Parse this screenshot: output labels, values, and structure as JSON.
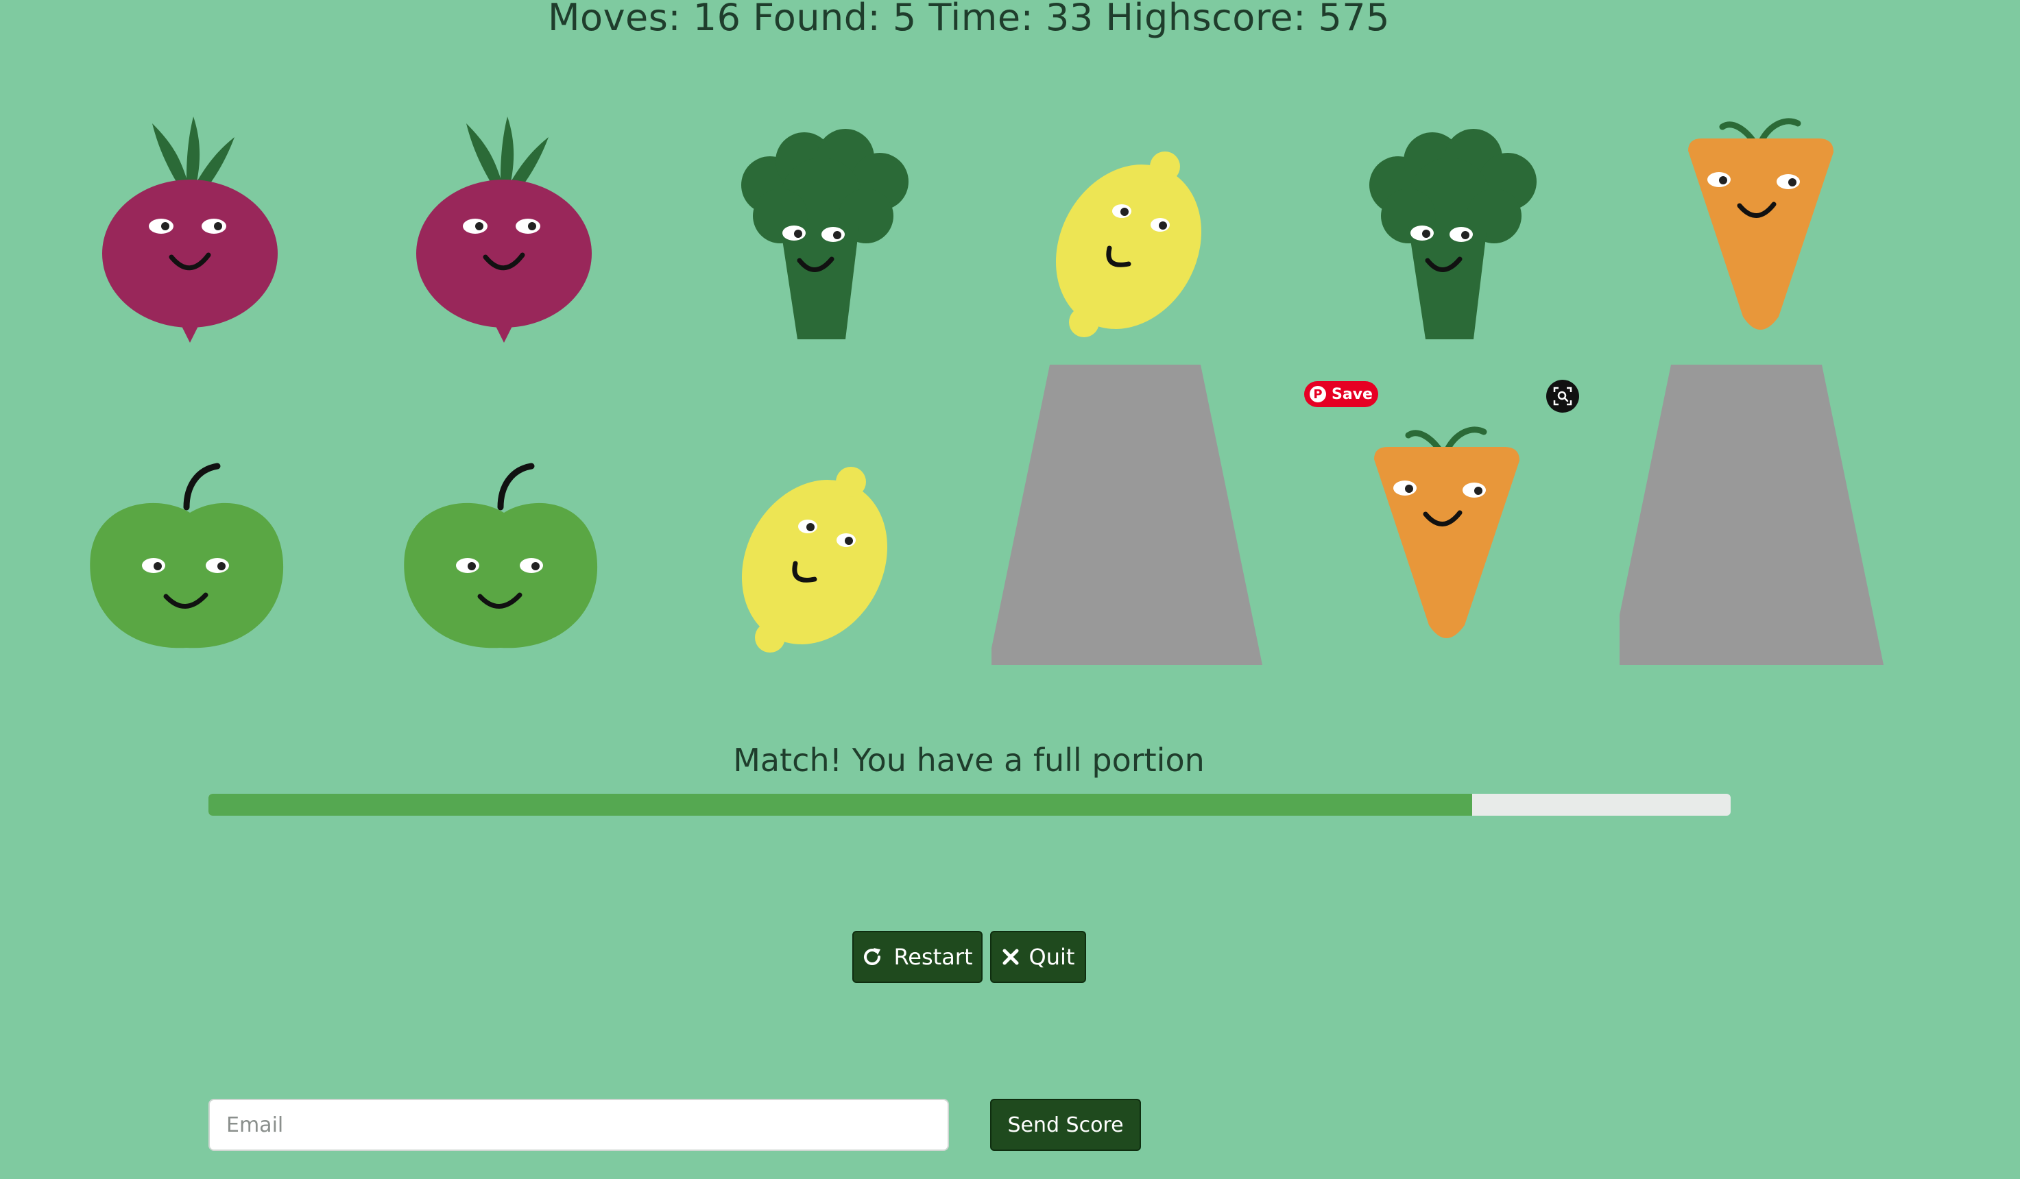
{
  "stats": {
    "moves_label": "Moves:",
    "moves": "16",
    "found_label": "Found:",
    "found": "5",
    "time_label": "Time:",
    "time": "33",
    "highscore_label": "Highscore:",
    "highscore": "575"
  },
  "cards": [
    {
      "state": "face-up",
      "veg": "beetroot"
    },
    {
      "state": "face-up",
      "veg": "beetroot"
    },
    {
      "state": "face-up",
      "veg": "broccoli"
    },
    {
      "state": "face-up",
      "veg": "lemon"
    },
    {
      "state": "face-up",
      "veg": "broccoli"
    },
    {
      "state": "face-up",
      "veg": "carrot"
    },
    {
      "state": "face-up",
      "veg": "apple"
    },
    {
      "state": "face-up",
      "veg": "apple"
    },
    {
      "state": "face-up",
      "veg": "lemon"
    },
    {
      "state": "face-down",
      "veg": "card-back"
    },
    {
      "state": "face-up",
      "veg": "carrot"
    },
    {
      "state": "face-down",
      "veg": "card-back"
    }
  ],
  "message": "Match! You have a full portion",
  "progress_fraction": 0.83,
  "buttons": {
    "restart_label": "Restart",
    "restart_icon": "redo-icon",
    "quit_label": "Quit",
    "quit_icon": "close-icon",
    "send_label": "Send Score"
  },
  "email": {
    "placeholder": "Email",
    "value": ""
  },
  "overlay": {
    "pin_save_label": "Save",
    "lens_icon": "visual-search-icon"
  },
  "colors": {
    "background": "#7fcaa0",
    "beetroot": "#99275a",
    "broccoli": "#2b6a37",
    "lemon": "#ede554",
    "carrot": "#e8973a",
    "apple": "#5aa744",
    "card_back": "#999999",
    "progress": "#55a851",
    "button": "#1f4a1e"
  }
}
